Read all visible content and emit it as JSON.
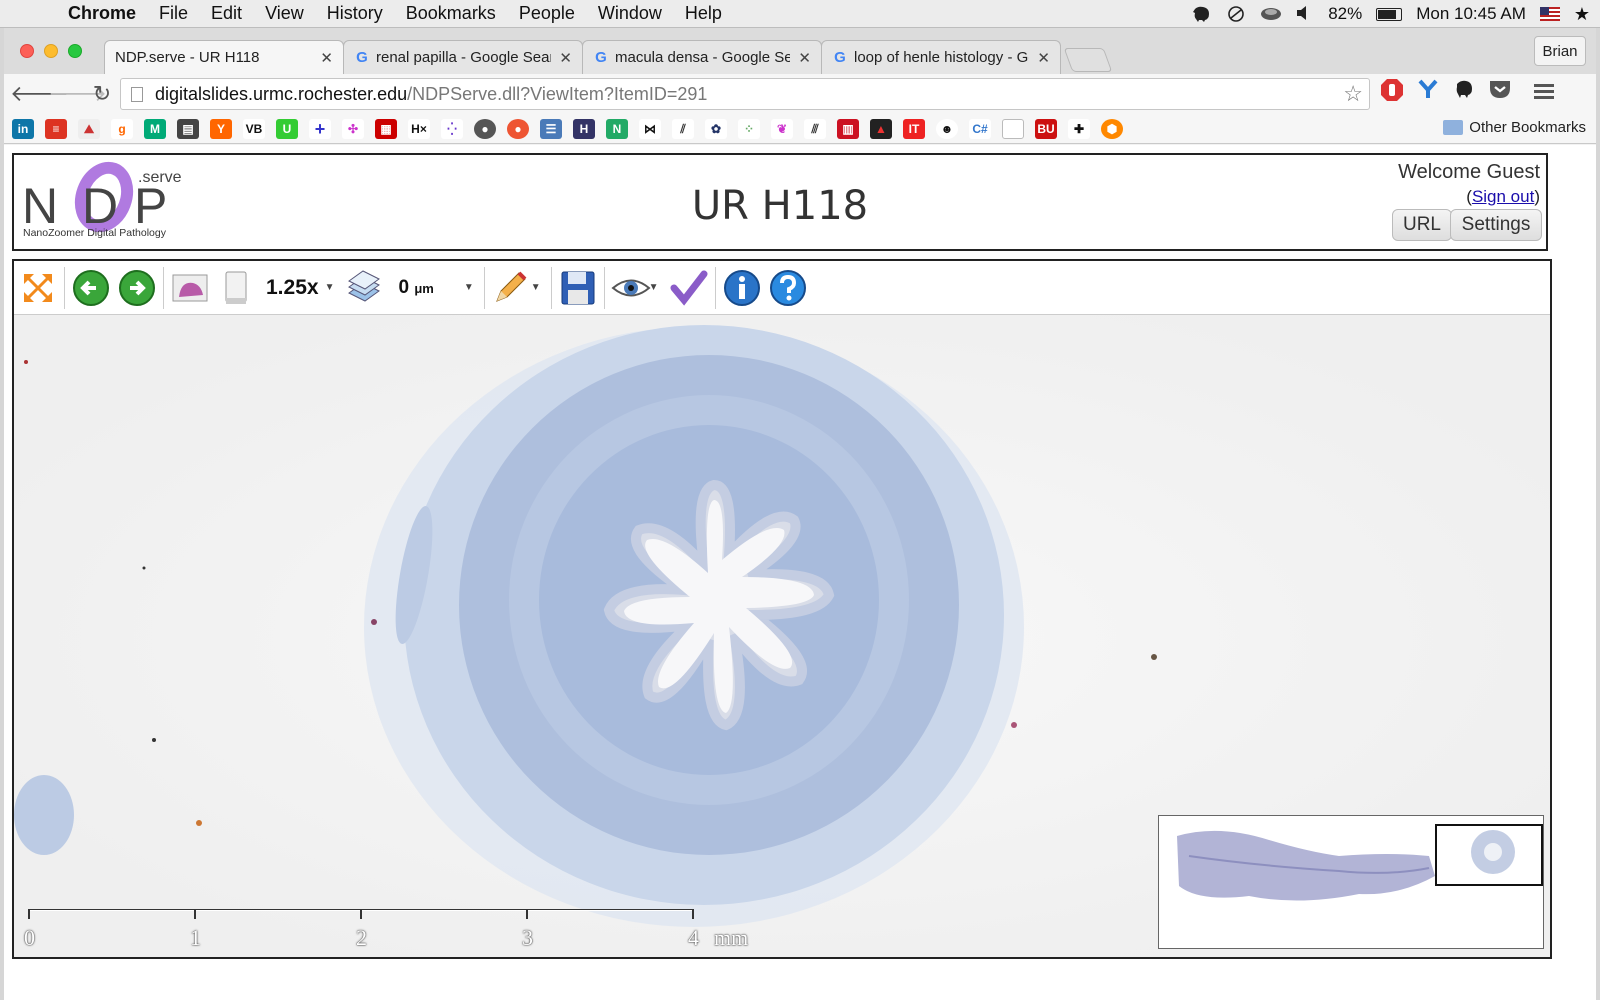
{
  "menubar": {
    "app": "Chrome",
    "items": [
      "File",
      "Edit",
      "View",
      "History",
      "Bookmarks",
      "People",
      "Window",
      "Help"
    ],
    "battery": "82%",
    "battery_fraction": 0.82,
    "clock": "Mon 10:45 AM"
  },
  "browser": {
    "tabs": [
      {
        "label": "NDP.serve - UR H118",
        "icon": "page-icon",
        "active": true
      },
      {
        "label": "renal papilla - Google Search",
        "icon": "google-icon",
        "active": false
      },
      {
        "label": "macula densa - Google Search",
        "icon": "google-icon",
        "active": false
      },
      {
        "label": "loop of henle histology - Google Search",
        "icon": "google-icon",
        "active": false
      }
    ],
    "profile": "Brian",
    "url_host": "digitalslides.urmc.rochester.edu",
    "url_path": "/NDPServe.dll?ViewItem?ItemID=291",
    "other_bookmarks": "Other Bookmarks"
  },
  "header": {
    "logo_text": "NanoZoomer Digital Pathology",
    "logo_serve": ".serve",
    "title": "UR H118",
    "welcome": "Welcome Guest",
    "signout_open": "(",
    "signout_link": "Sign out",
    "signout_close": ")",
    "url_button": "URL",
    "settings_button": "Settings"
  },
  "viewer": {
    "zoom": "1.25x",
    "depth_value": "0",
    "depth_unit": "μm",
    "scale": {
      "ticks": [
        "0",
        "1",
        "2",
        "3",
        "4"
      ],
      "unit": "mm"
    }
  },
  "colors": {
    "accent": "#a970d6",
    "tissue": "#9db3d6"
  }
}
